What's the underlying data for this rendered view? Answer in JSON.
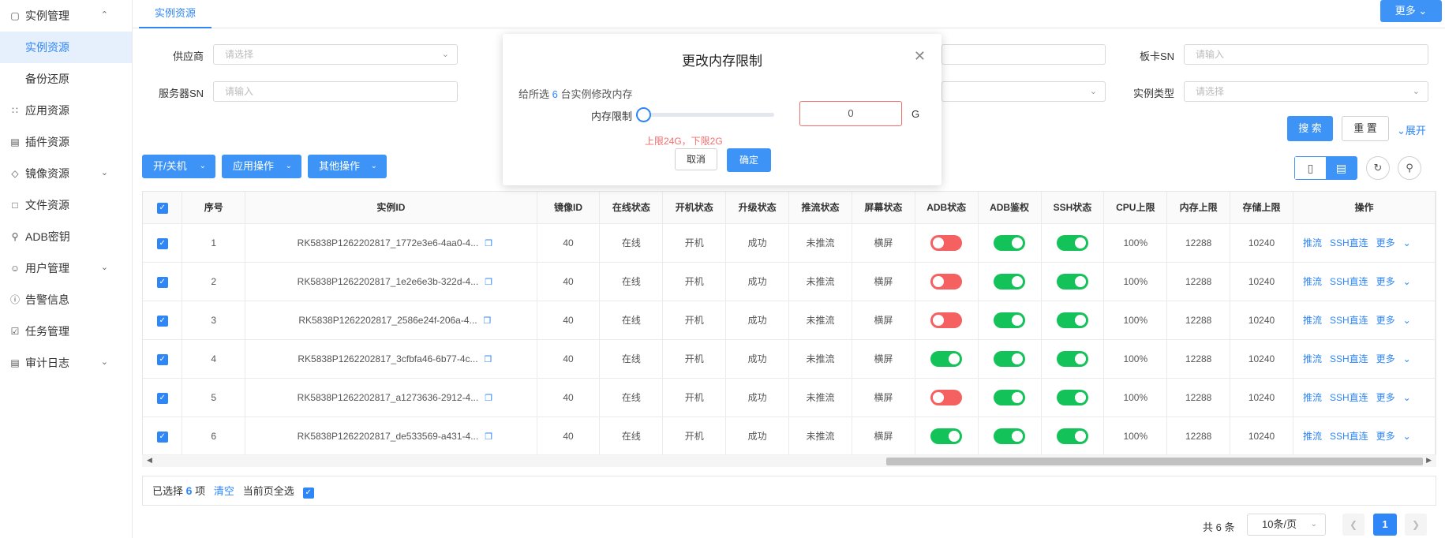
{
  "sidebar": {
    "group1": {
      "icon": "monitor-icon",
      "label": "实例管理"
    },
    "sub": [
      {
        "label": "实例资源",
        "active": true
      },
      {
        "label": "备份还原",
        "active": false
      }
    ],
    "items": [
      {
        "icon": "apps-icon",
        "label": "应用资源",
        "chevron": false
      },
      {
        "icon": "plugin-icon",
        "label": "插件资源",
        "chevron": false
      },
      {
        "icon": "image-icon",
        "label": "镜像资源",
        "chevron": true
      },
      {
        "icon": "folder-icon",
        "label": "文件资源",
        "chevron": false
      },
      {
        "icon": "key-icon",
        "label": "ADB密钥",
        "chevron": false
      },
      {
        "icon": "user-icon",
        "label": "用户管理",
        "chevron": true
      },
      {
        "icon": "info-icon",
        "label": "告警信息",
        "chevron": false
      },
      {
        "icon": "task-icon",
        "label": "任务管理",
        "chevron": false
      },
      {
        "icon": "log-icon",
        "label": "审计日志",
        "chevron": true
      }
    ]
  },
  "tabs": {
    "active": "实例资源"
  },
  "header": {
    "more": "更多"
  },
  "filters": {
    "vendor_label": "供应商",
    "vendor_placeholder": "请选择",
    "server_sn_label": "服务器SN",
    "server_sn_placeholder": "请输入",
    "board_sn_label": "板卡SN",
    "board_sn_placeholder": "请输入",
    "instance_type_label": "实例类型",
    "instance_type_placeholder": "请选择",
    "search": "搜 索",
    "reset": "重 置",
    "expand": "展开"
  },
  "ops": {
    "power": "开/关机",
    "app_ops": "应用操作",
    "other_ops": "其他操作"
  },
  "table": {
    "headers": [
      "序号",
      "实例ID",
      "镜像ID",
      "在线状态",
      "开机状态",
      "升级状态",
      "推流状态",
      "屏幕状态",
      "ADB状态",
      "ADB鉴权",
      "SSH状态",
      "CPU上限",
      "内存上限",
      "存储上限",
      "操作"
    ],
    "rows": [
      {
        "no": "1",
        "id": "RK5838P1262202817_1772e3e6-4aa0-4...",
        "image": "40",
        "online": "在线",
        "power": "开机",
        "upgrade": "成功",
        "stream": "未推流",
        "screen": "横屏",
        "adb": false,
        "adb_auth": true,
        "ssh": true,
        "cpu": "100%",
        "mem": "12288",
        "storage": "10240"
      },
      {
        "no": "2",
        "id": "RK5838P1262202817_1e2e6e3b-322d-4...",
        "image": "40",
        "online": "在线",
        "power": "开机",
        "upgrade": "成功",
        "stream": "未推流",
        "screen": "横屏",
        "adb": false,
        "adb_auth": true,
        "ssh": true,
        "cpu": "100%",
        "mem": "12288",
        "storage": "10240"
      },
      {
        "no": "3",
        "id": "RK5838P1262202817_2586e24f-206a-4...",
        "image": "40",
        "online": "在线",
        "power": "开机",
        "upgrade": "成功",
        "stream": "未推流",
        "screen": "横屏",
        "adb": false,
        "adb_auth": true,
        "ssh": true,
        "cpu": "100%",
        "mem": "12288",
        "storage": "10240"
      },
      {
        "no": "4",
        "id": "RK5838P1262202817_3cfbfa46-6b77-4c...",
        "image": "40",
        "online": "在线",
        "power": "开机",
        "upgrade": "成功",
        "stream": "未推流",
        "screen": "横屏",
        "adb": true,
        "adb_auth": true,
        "ssh": true,
        "cpu": "100%",
        "mem": "12288",
        "storage": "10240"
      },
      {
        "no": "5",
        "id": "RK5838P1262202817_a1273636-2912-4...",
        "image": "40",
        "online": "在线",
        "power": "开机",
        "upgrade": "成功",
        "stream": "未推流",
        "screen": "横屏",
        "adb": false,
        "adb_auth": true,
        "ssh": true,
        "cpu": "100%",
        "mem": "12288",
        "storage": "10240"
      },
      {
        "no": "6",
        "id": "RK5838P1262202817_de533569-a431-4...",
        "image": "40",
        "online": "在线",
        "power": "开机",
        "upgrade": "成功",
        "stream": "未推流",
        "screen": "横屏",
        "adb": true,
        "adb_auth": true,
        "ssh": true,
        "cpu": "100%",
        "mem": "12288",
        "storage": "10240"
      }
    ],
    "row_actions": {
      "stream": "推流",
      "ssh": "SSH直连",
      "more": "更多"
    }
  },
  "selection": {
    "prefix": "已选择",
    "count": "6",
    "suffix": "项",
    "clear": "清空",
    "select_page": "当前页全选"
  },
  "pager": {
    "total": "共 6 条",
    "page_size": "10条/页",
    "current": "1"
  },
  "modal": {
    "title": "更改内存限制",
    "desc_prefix": "给所选",
    "desc_count": "6",
    "desc_suffix": "台实例修改内存",
    "mem_label": "内存限制",
    "slider_value": 0,
    "value": "0",
    "unit": "G",
    "error": "上限24G，下限2G",
    "cancel": "取消",
    "ok": "确定"
  },
  "colors": {
    "primary": "#3d94f6",
    "switch_on": "#13c35a",
    "switch_off": "#f56060",
    "error": "#f56c6c"
  }
}
